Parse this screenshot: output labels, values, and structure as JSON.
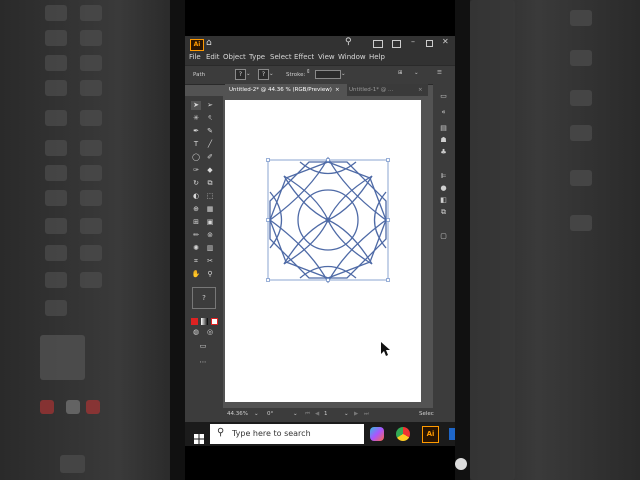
{
  "window": {
    "app_badge": "Ai",
    "menus": [
      "File",
      "Edit",
      "Object",
      "Type",
      "Select",
      "Effect",
      "View",
      "Window",
      "Help"
    ]
  },
  "controlbar": {
    "object_type": "Path",
    "fill_glyph": "?",
    "stroke_glyph": "?",
    "stroke_label": "Stroke:"
  },
  "tabs": [
    {
      "label": "Untitled-2* @ 44.36 % (RGB/Preview)",
      "close": "×",
      "active": true
    },
    {
      "label": "Untitled-1* @ ...",
      "close": "×",
      "active": false
    }
  ],
  "statusbar": {
    "zoom": "44.36%",
    "rotation": "0°",
    "artboard_number": "1",
    "tool_name": "Selec"
  },
  "taskbar": {
    "search_placeholder": "Type here to search",
    "illustrator_badge": "Ai"
  },
  "colors": {
    "app_bg": "#535353",
    "panel_bg": "#3c3c3c",
    "selection_blue": "#5b7fbf",
    "pattern_stroke": "#4e6aa6",
    "ai_orange": "#ff9a00"
  }
}
